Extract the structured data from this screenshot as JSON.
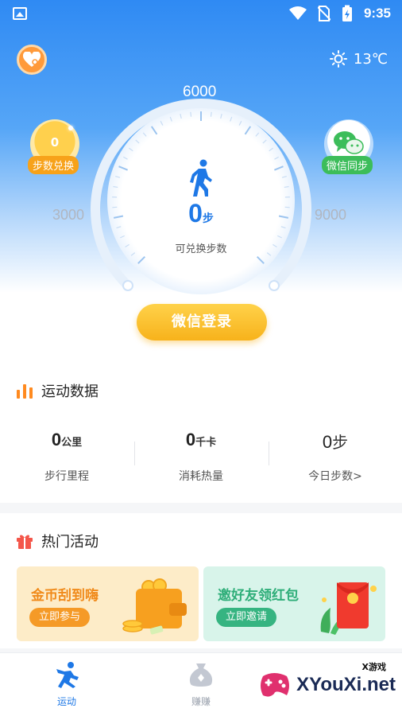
{
  "status_bar": {
    "time": "9:35"
  },
  "weather": {
    "temp": "13℃"
  },
  "gauge": {
    "mark_top": "6000",
    "mark_left": "3000",
    "mark_right": "9000",
    "steps": "0",
    "steps_unit": "步",
    "steps_label": "可兑换步数"
  },
  "bubbles": {
    "exchange_count": "0",
    "exchange_label": "步数兑换",
    "wechat_label": "微信同步"
  },
  "login_button": "微信登录",
  "sport_data": {
    "title": "运动数据",
    "stats": [
      {
        "value": "0",
        "unit": "公里",
        "label": "步行里程"
      },
      {
        "value": "0",
        "unit": "千卡",
        "label": "消耗热量"
      },
      {
        "value": "0",
        "unit": "步",
        "label": "今日步数>"
      }
    ]
  },
  "hot": {
    "title": "热门活动",
    "promos": [
      {
        "title": "金币刮到嗨",
        "button": "立即参与"
      },
      {
        "title": "邀好友领红包",
        "button": "立即邀请"
      }
    ]
  },
  "tabs": [
    {
      "label": "运动",
      "active": true
    },
    {
      "label": "赚赚",
      "active": false
    }
  ],
  "watermark": {
    "brand": "XYouXi.net",
    "sub": "X游戏"
  },
  "colors": {
    "primary": "#1e78e6",
    "accent": "#f7b21b",
    "green": "#36b481"
  }
}
